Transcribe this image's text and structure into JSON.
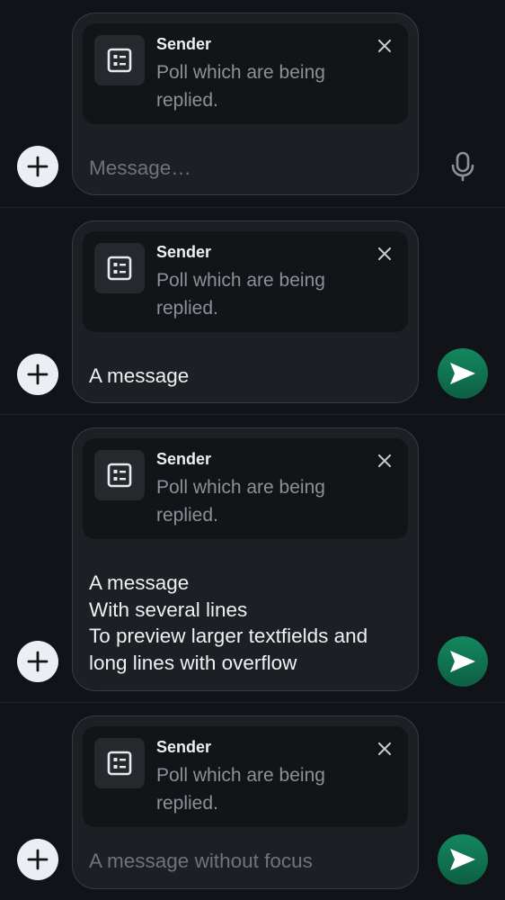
{
  "colors": {
    "background": "#101318",
    "composer": "#1c1f24",
    "reply_card": "#121418",
    "send_button": "#0f7a55",
    "placeholder": "#6f747c",
    "secondary_text": "#8b9099",
    "primary_text": "#eef0f3"
  },
  "composers": [
    {
      "reply": {
        "sender": "Sender",
        "text": "Poll which are being replied.",
        "icon": "poll-icon"
      },
      "message": "",
      "placeholder": "Message…",
      "trailing_action": "microphone-icon"
    },
    {
      "reply": {
        "sender": "Sender",
        "text": "Poll which are being replied.",
        "icon": "poll-icon"
      },
      "message": "A message",
      "placeholder": "",
      "trailing_action": "send-icon"
    },
    {
      "reply": {
        "sender": "Sender",
        "text": "Poll which are being replied.",
        "icon": "poll-icon"
      },
      "message": "A message\nWith several lines\nTo preview larger textfields and\nlong lines with overflow",
      "placeholder": "",
      "trailing_action": "send-icon"
    },
    {
      "reply": {
        "sender": "Sender",
        "text": "Poll which are being replied.",
        "icon": "poll-icon"
      },
      "message": "",
      "placeholder": "A message without focus",
      "trailing_action": "send-icon"
    }
  ]
}
